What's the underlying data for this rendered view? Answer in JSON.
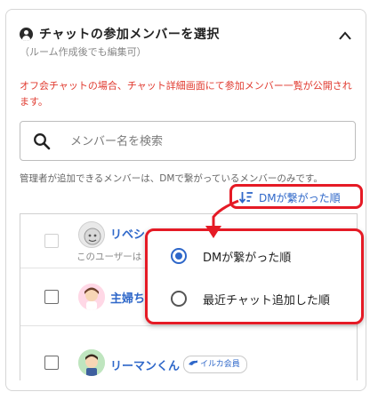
{
  "header": {
    "title": "チャットの参加メンバーを選択",
    "subtitle": "（ルーム作成後でも編集可）"
  },
  "notice": "オフ会チャットの場合、チャット詳細画面にて参加メンバー一覧が公開されます。",
  "search": {
    "placeholder": "メンバー名を検索"
  },
  "admin_note": "管理者が追加できるメンバーは、DMで繋がっているメンバーのみです。",
  "sort": {
    "current_label": "DMが繋がった順"
  },
  "members": [
    {
      "name": "リベシ",
      "note": "このユーザーは",
      "selectable": false
    },
    {
      "name": "主婦ち",
      "selectable": true
    },
    {
      "name": "リーマンくん",
      "badge": "イルカ会員",
      "selectable": true
    }
  ],
  "sort_menu": {
    "options": [
      {
        "label": "DMが繋がった順",
        "selected": true
      },
      {
        "label": "最近チャット追加した順",
        "selected": false
      }
    ]
  },
  "colors": {
    "accent": "#2e67c9",
    "warning": "#e03a2f",
    "highlight": "#e51a25"
  }
}
